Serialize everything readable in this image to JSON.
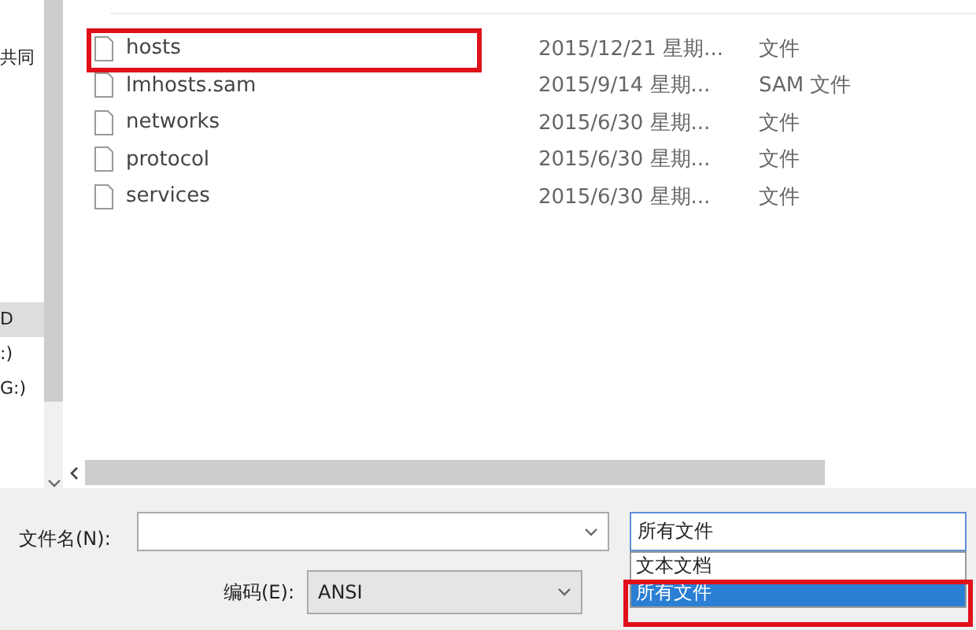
{
  "nav_items": [
    {
      "label": "共同",
      "selected": false
    },
    {
      "label": "D",
      "selected": true
    },
    {
      "label": ":)",
      "selected": false
    },
    {
      "label": "G:)",
      "selected": false
    }
  ],
  "files": [
    {
      "name": "hosts",
      "date": "2015/12/21 星期...",
      "type": "文件",
      "annotated": true
    },
    {
      "name": "lmhosts.sam",
      "date": "2015/9/14 星期...",
      "type": "SAM 文件",
      "annotated": false
    },
    {
      "name": "networks",
      "date": "2015/6/30 星期...",
      "type": "文件",
      "annotated": false
    },
    {
      "name": "protocol",
      "date": "2015/6/30 星期...",
      "type": "文件",
      "annotated": false
    },
    {
      "name": "services",
      "date": "2015/6/30 星期...",
      "type": "文件",
      "annotated": false
    }
  ],
  "file_name": {
    "label": "文件名(N):"
  },
  "encoding": {
    "label": "编码(E):",
    "value": "ANSI"
  },
  "file_type": {
    "value": "所有文件",
    "options": [
      {
        "label": "文本文档",
        "selected": false,
        "annotated": false
      },
      {
        "label": "所有文件",
        "selected": true,
        "annotated": true
      }
    ]
  }
}
